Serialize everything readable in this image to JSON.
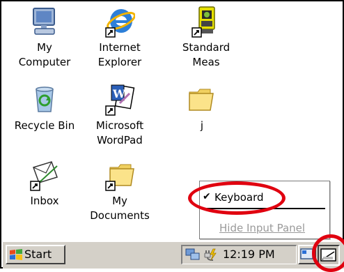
{
  "desktop": {
    "icons": [
      {
        "name": "my-computer",
        "label": "My\nComputer"
      },
      {
        "name": "internet-explorer",
        "label": "Internet\nExplorer"
      },
      {
        "name": "standard-meas",
        "label": "Standard\nMeas"
      },
      {
        "name": "recycle-bin",
        "label": "Recycle Bin"
      },
      {
        "name": "wordpad",
        "label": "Microsoft\nWordPad"
      },
      {
        "name": "folder-j",
        "label": "j"
      },
      {
        "name": "inbox",
        "label": "Inbox"
      },
      {
        "name": "my-documents",
        "label": "My\nDocuments"
      }
    ]
  },
  "input_menu": {
    "checkmark": "✔",
    "keyboard_label": "Keyboard",
    "hide_label": "Hide Input Panel"
  },
  "taskbar": {
    "start_label": "Start",
    "clock": "12:19 PM"
  },
  "colors": {
    "callout": "#e0000f",
    "taskbar": "#d4d0c8",
    "disabled_text": "#9a9a9a"
  }
}
